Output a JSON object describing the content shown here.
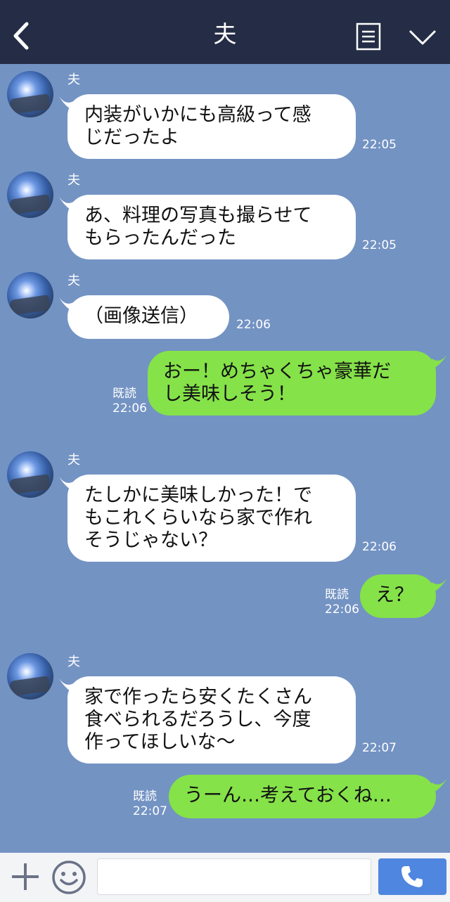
{
  "header": {
    "title": "夫",
    "icons": [
      "back-icon",
      "note-icon",
      "chevron-down-icon"
    ]
  },
  "messages": [
    {
      "sender": "夫",
      "text": "内装がいかにも高級って感\nじだったよ",
      "time": "22:05"
    },
    {
      "sender": "夫",
      "text": "あ、料理の写真も撮らせて\nもらったんだった",
      "time": "22:05"
    },
    {
      "sender": "夫",
      "text": "（画像送信）",
      "time": "22:06"
    },
    {
      "text": "おー！めちゃくちゃ豪華だ\nし美味しそう！",
      "read": "既読",
      "time": "22:06"
    },
    {
      "sender": "夫",
      "text": "たしかに美味しかった！で\nもこれくらいなら家で作れ\nそうじゃない？",
      "time": "22:06"
    },
    {
      "text": "え？",
      "read": "既読",
      "time": "22:06"
    },
    {
      "sender": "夫",
      "text": "家で作ったら安くたくさん\n食べられるだろうし、今度\n作ってほしいな〜",
      "time": "22:07"
    },
    {
      "text": "うーん…考えておくね…",
      "read": "既読",
      "time": "22:07"
    }
  ],
  "input": {
    "value": "",
    "placeholder": ""
  },
  "colors": {
    "background": "#7393c3",
    "header": "#242d45",
    "bubble_in": "#ffffff",
    "bubble_out": "#85e249",
    "call_button": "#4f86df"
  }
}
